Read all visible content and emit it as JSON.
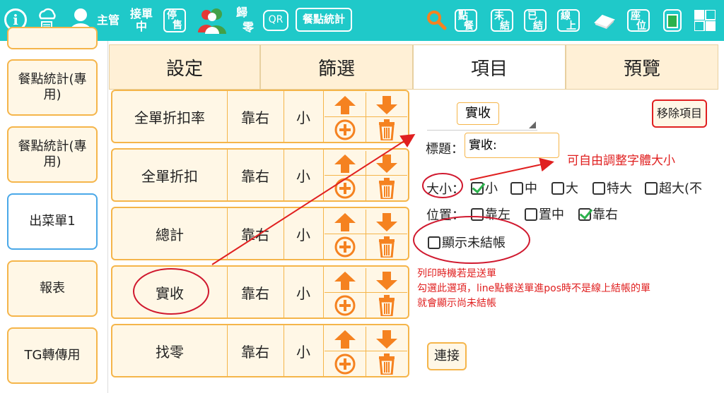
{
  "topbar": {
    "supervisor_label": "主管",
    "receive_order_label_1": "接單",
    "receive_order_label_2": "中",
    "stop_sale_label_1": "停",
    "stop_sale_label_2": "售",
    "change_label_1": "歸",
    "change_label_2": "零",
    "qr_label": "QR",
    "meal_stats_label": "餐點統計",
    "order_label_1": "點",
    "order_label_2": "餐",
    "unsettled_label_1": "未",
    "unsettled_label_2": "結",
    "settled_label_1": "已",
    "settled_label_2": "結",
    "online_label_1": "線",
    "online_label_2": "上",
    "seat_label_1": "座",
    "seat_label_2": "位"
  },
  "sidebar": {
    "items": [
      {
        "label": "餐點統計(專用)"
      },
      {
        "label": "餐點統計(專用)"
      },
      {
        "label": "出菜單1"
      },
      {
        "label": "報表"
      },
      {
        "label": "TG轉傳用"
      }
    ]
  },
  "tabs": [
    {
      "label": "設定"
    },
    {
      "label": "篩選"
    },
    {
      "label": "項目"
    },
    {
      "label": "預覽"
    }
  ],
  "rows": [
    {
      "name": "全單折扣率",
      "align": "靠右",
      "size": "小"
    },
    {
      "name": "全單折扣",
      "align": "靠右",
      "size": "小"
    },
    {
      "name": "總計",
      "align": "靠右",
      "size": "小"
    },
    {
      "name": "實收",
      "align": "靠右",
      "size": "小"
    },
    {
      "name": "找零",
      "align": "靠右",
      "size": "小"
    }
  ],
  "detail": {
    "item_select": "實收",
    "remove_button": "移除項目",
    "title_label": "標題：",
    "title_value": "實收:",
    "size_label": "大小：",
    "size_options": [
      "小",
      "中",
      "大",
      "特大",
      "超大(不"
    ],
    "position_label": "位置：",
    "position_options": [
      "靠左",
      "置中",
      "靠右"
    ],
    "show_unsettled": "顯示未結帳",
    "connect_button": "連接"
  },
  "annotations": {
    "font_size_note": "可自由調整字體大小",
    "print_note_1": "列印時機若是送單",
    "print_note_2": "勾選此選項，line點餐送單進pos時不是線上結帳的單",
    "print_note_3": "就會顯示尚未結帳"
  },
  "colors": {
    "topbar": "#1fc9c9",
    "accent_orange": "#f58220",
    "annotation_red": "#e02020",
    "check_green": "#2bb24c"
  }
}
